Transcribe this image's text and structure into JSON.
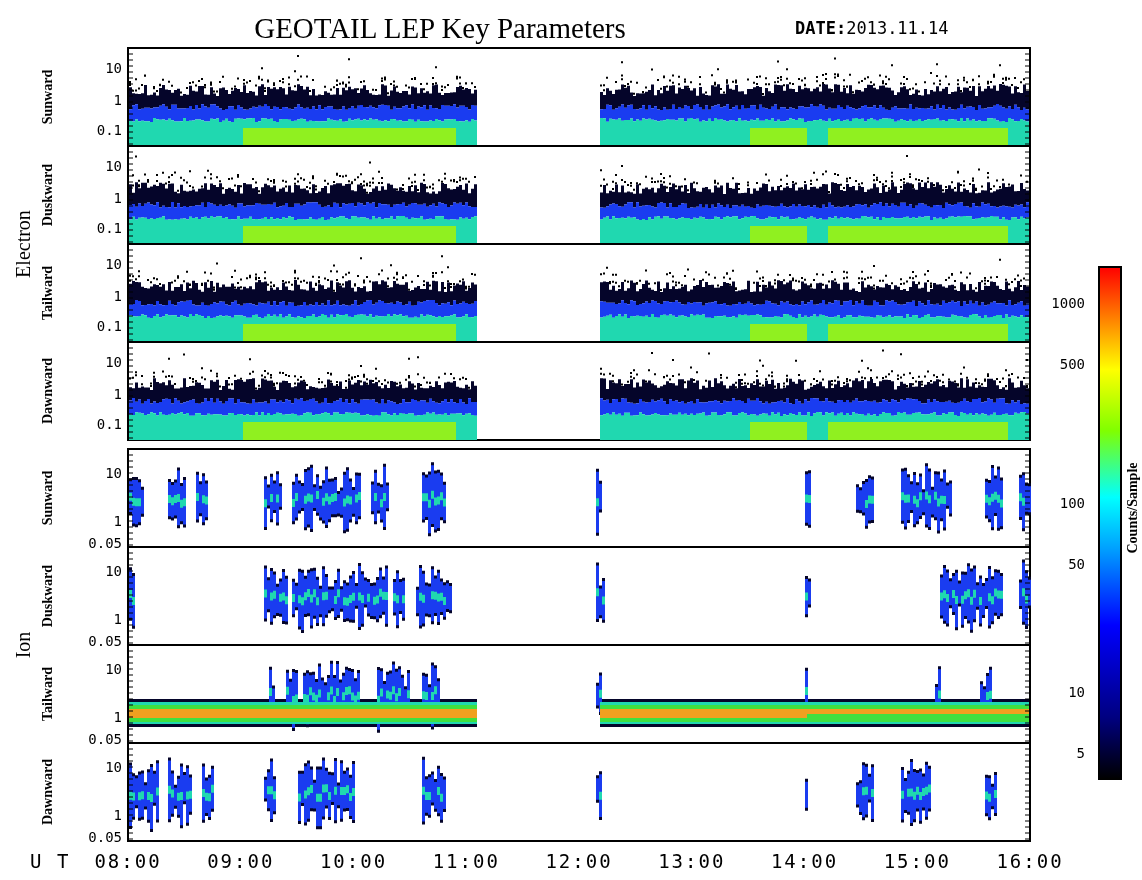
{
  "title": "GEOTAIL LEP Key Parameters",
  "date": "**DATE:**2013.11.14",
  "groups": [
    {
      "label": "Electron",
      "kind": "electron",
      "panels": [
        {
          "label": "Sunward",
          "yticks": [
            "10",
            "1",
            "0.1"
          ]
        },
        {
          "label": "Duskward",
          "yticks": [
            "10",
            "1",
            "0.1"
          ]
        },
        {
          "label": "Tailward",
          "yticks": [
            "10",
            "1",
            "0.1"
          ]
        },
        {
          "label": "Dawnward",
          "yticks": [
            "10",
            "1",
            "0.1"
          ]
        }
      ]
    },
    {
      "label": "Ion",
      "kind": "ion",
      "panels": [
        {
          "label": "Sunward",
          "yticks": [
            "10",
            "1",
            "0.05"
          ]
        },
        {
          "label": "Duskward",
          "yticks": [
            "10",
            "1",
            "0.05"
          ]
        },
        {
          "label": "Tailward",
          "yticks": [
            "10",
            "1",
            "0.05"
          ]
        },
        {
          "label": "Dawnward",
          "yticks": [
            "10",
            "1",
            "0.05"
          ]
        }
      ]
    }
  ],
  "x_axis": {
    "unit": "U T",
    "ticks": [
      "08:00",
      "09:00",
      "10:00",
      "11:00",
      "12:00",
      "13:00",
      "14:00",
      "15:00",
      "16:00"
    ]
  },
  "colorbar": {
    "label": "Counts/Sample",
    "ticks": [
      "1000",
      "500",
      "100",
      "50",
      "10",
      "5"
    ]
  }
}
